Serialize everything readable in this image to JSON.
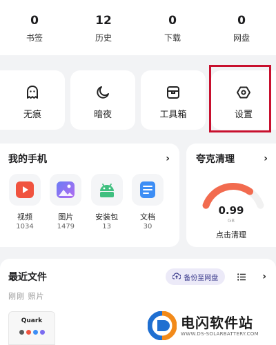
{
  "stats": [
    {
      "value": "0",
      "label": "书签"
    },
    {
      "value": "12",
      "label": "历史"
    },
    {
      "value": "0",
      "label": "下载"
    },
    {
      "value": "0",
      "label": "网盘"
    }
  ],
  "tools": [
    {
      "label": "无痕",
      "icon": "ghost-icon"
    },
    {
      "label": "暗夜",
      "icon": "moon-icon"
    },
    {
      "label": "工具箱",
      "icon": "toolbox-icon"
    },
    {
      "label": "设置",
      "icon": "settings-hexagon-icon"
    }
  ],
  "phone": {
    "title": "我的手机",
    "chevron": "›",
    "apps": [
      {
        "label": "视频",
        "count": "1034",
        "icon": "video-icon",
        "color": "#f0533f"
      },
      {
        "label": "图片",
        "count": "1479",
        "icon": "image-icon",
        "color": "#7b6cf0"
      },
      {
        "label": "安装包",
        "count": "13",
        "icon": "android-icon",
        "color": "#3fbf7f"
      },
      {
        "label": "文档",
        "count": "30",
        "icon": "document-icon",
        "color": "#3d8ef5"
      }
    ]
  },
  "clean": {
    "title": "夸克清理",
    "chevron": "›",
    "value": "0.99",
    "unit": "GB",
    "label": "点击清理",
    "fill_fraction": 0.75,
    "gauge_color": "#f26b4f",
    "track_color": "#f1f1f1"
  },
  "recent": {
    "title": "最近文件",
    "backup_label": "备份至网盘",
    "chevron": "›",
    "subtitle": "刚刚 照片",
    "thumb_title": "Quark"
  },
  "watermark": {
    "name": "电闪软件站",
    "url": "WWW.DS-SOLARBATTERY.COM"
  }
}
